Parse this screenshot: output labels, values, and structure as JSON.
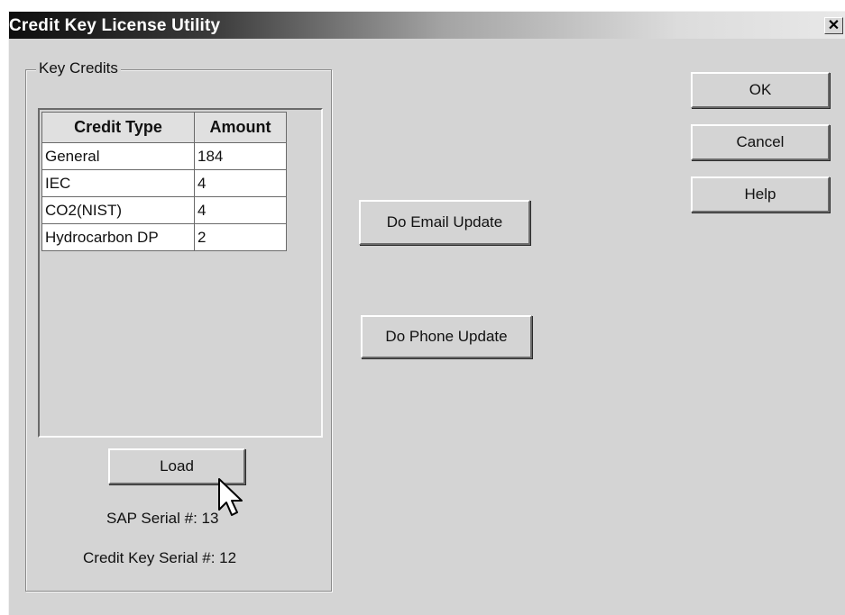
{
  "window": {
    "title": "Credit Key License Utility"
  },
  "titlebar": {
    "close_glyph": "✕"
  },
  "group": {
    "legend": "Key Credits"
  },
  "table": {
    "headers": [
      "Credit Type",
      "Amount"
    ],
    "rows": [
      [
        "General",
        "184"
      ],
      [
        "IEC",
        "4"
      ],
      [
        "CO2(NIST)",
        "4"
      ],
      [
        "Hydrocarbon DP",
        "2"
      ]
    ]
  },
  "buttons": {
    "load": "Load",
    "email_update": "Do Email Update",
    "phone_update": "Do Phone Update",
    "ok": "OK",
    "cancel": "Cancel",
    "help": "Help"
  },
  "info": {
    "sap_serial": "SAP Serial #: 13",
    "credit_key_serial": "Credit Key Serial #: 12"
  },
  "icons": {
    "cursor": "arrow-cursor-icon"
  }
}
